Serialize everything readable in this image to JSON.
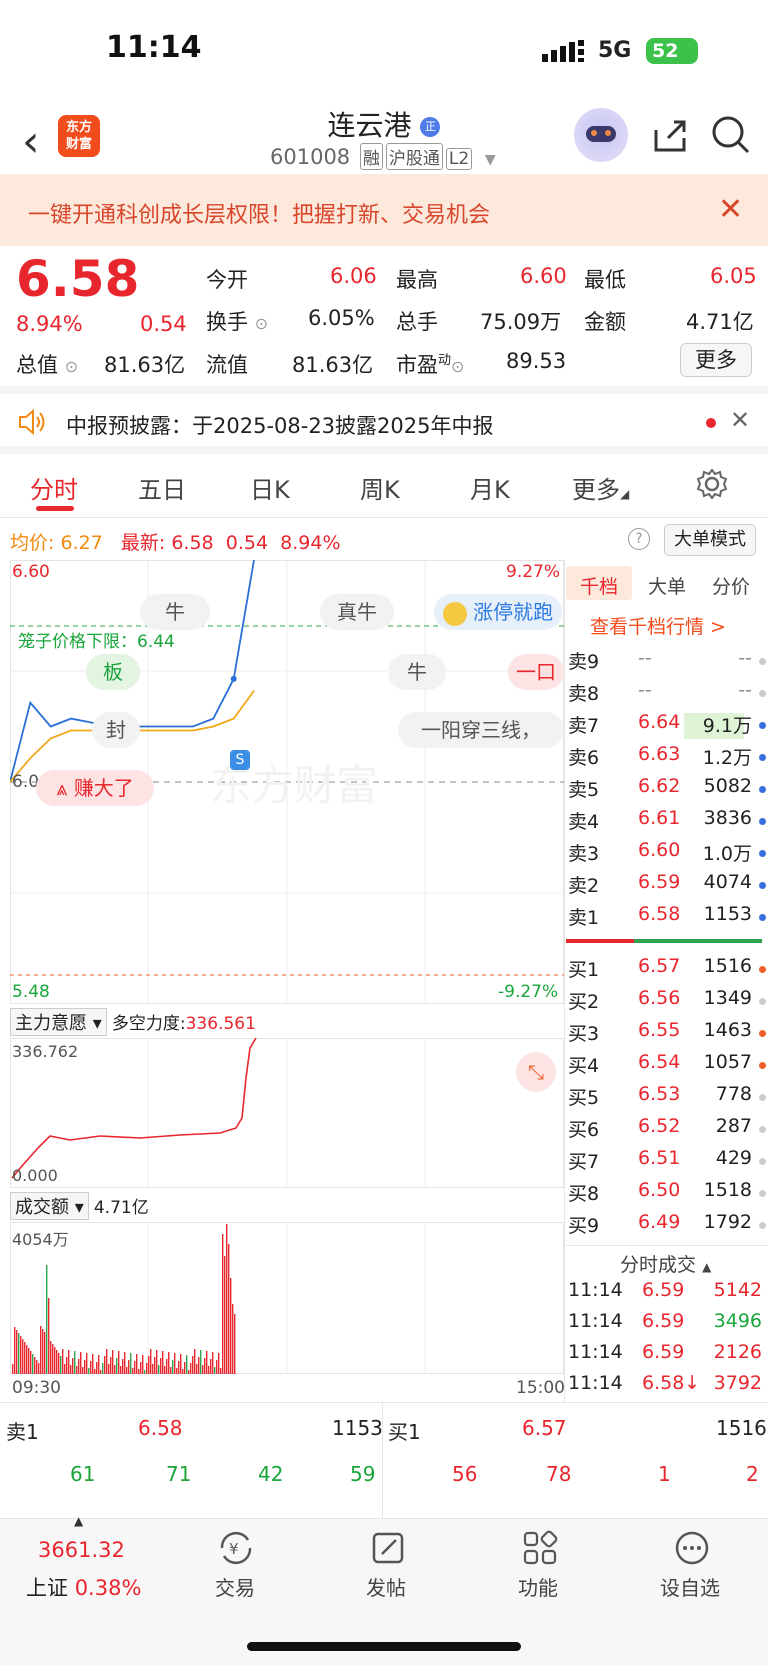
{
  "status": {
    "time": "11:14",
    "network": "5G",
    "battery": "52"
  },
  "header": {
    "title": "连云港",
    "code": "601008",
    "tags": [
      "融",
      "沪股通",
      "L2"
    ],
    "logo": "东方\n财富"
  },
  "banner": {
    "text": "一键开通科创成长层权限！把握打新、交易机会"
  },
  "quote": {
    "price": "6.58",
    "pct": "8.94%",
    "change": "0.54",
    "open_label": "今开",
    "open": "6.06",
    "high_label": "最高",
    "high": "6.60",
    "low_label": "最低",
    "low": "6.05",
    "turnover_label": "换手",
    "turnover": "6.05%",
    "volume_label": "总手",
    "volume": "75.09万",
    "amount_label": "金额",
    "amount": "4.71亿",
    "mktcap_label": "总值",
    "mktcap": "81.63亿",
    "float_label": "流值",
    "float": "81.63亿",
    "pe_label": "市盈",
    "pe_sup": "动",
    "pe": "89.53",
    "more": "更多"
  },
  "notice": {
    "text": "中报预披露：于2025-08-23披露2025年中报"
  },
  "tabs": [
    "分时",
    "五日",
    "日K",
    "周K",
    "月K",
    "更多"
  ],
  "chart_bar": {
    "avg_label": "均价:",
    "avg": "6.27",
    "latest_label": "最新:",
    "latest": "6.58",
    "chg": "0.54",
    "pct": "8.94%",
    "mode": "大单模式"
  },
  "price_chart": {
    "top_left": "6.60",
    "top_right": "9.27%",
    "mid_left": "6.04",
    "bottom_left": "5.48",
    "bottom_right": "-9.27%",
    "cage_label": "笼子价格下限：6.44",
    "bubbles": [
      "牛",
      "真牛",
      "涨停就跑",
      "板",
      "牛",
      "一口",
      "封",
      "一阳穿三线，",
      "赚大了"
    ],
    "watermark": "东方财富",
    "marker": "S"
  },
  "indicator": {
    "name": "主力意愿",
    "label": "多空力度:",
    "value": "336.561",
    "max": "336.762",
    "min": "0.000"
  },
  "volume_chart": {
    "name": "成交额",
    "value": "4.71亿",
    "max": "4054万",
    "start_time": "09:30",
    "end_time": "15:00"
  },
  "chart_data": {
    "type": "line",
    "title": "",
    "xlabel": "",
    "ylabel": "",
    "x": [
      "09:30",
      "09:40",
      "09:50",
      "10:00",
      "10:10",
      "10:20",
      "10:30",
      "10:40",
      "10:50",
      "11:00",
      "11:05",
      "11:10",
      "11:14"
    ],
    "ylim": [
      5.48,
      6.6
    ],
    "series": [
      {
        "values": [
          6.04,
          6.24,
          6.18,
          6.2,
          6.19,
          6.18,
          6.18,
          6.18,
          6.18,
          6.18,
          6.2,
          6.3,
          6.6
        ]
      },
      {
        "values": [
          6.04,
          6.1,
          6.15,
          6.17,
          6.17,
          6.17,
          6.17,
          6.17,
          6.17,
          6.17,
          6.18,
          6.2,
          6.27
        ]
      }
    ]
  },
  "orderbook": {
    "tabs": [
      "千档",
      "大单",
      "分价"
    ],
    "link": "查看千档行情 >",
    "asks": [
      {
        "label": "卖9",
        "price": "--",
        "vol": "--"
      },
      {
        "label": "卖8",
        "price": "--",
        "vol": "--"
      },
      {
        "label": "卖7",
        "price": "6.64",
        "vol": "9.1万"
      },
      {
        "label": "卖6",
        "price": "6.63",
        "vol": "1.2万"
      },
      {
        "label": "卖5",
        "price": "6.62",
        "vol": "5082"
      },
      {
        "label": "卖4",
        "price": "6.61",
        "vol": "3836"
      },
      {
        "label": "卖3",
        "price": "6.60",
        "vol": "1.0万"
      },
      {
        "label": "卖2",
        "price": "6.59",
        "vol": "4074"
      },
      {
        "label": "卖1",
        "price": "6.58",
        "vol": "1153"
      }
    ],
    "bids": [
      {
        "label": "买1",
        "price": "6.57",
        "vol": "1516"
      },
      {
        "label": "买2",
        "price": "6.56",
        "vol": "1349"
      },
      {
        "label": "买3",
        "price": "6.55",
        "vol": "1463"
      },
      {
        "label": "买4",
        "price": "6.54",
        "vol": "1057"
      },
      {
        "label": "买5",
        "price": "6.53",
        "vol": "778"
      },
      {
        "label": "买6",
        "price": "6.52",
        "vol": "287"
      },
      {
        "label": "买7",
        "price": "6.51",
        "vol": "429"
      },
      {
        "label": "买8",
        "price": "6.50",
        "vol": "1518"
      },
      {
        "label": "买9",
        "price": "6.49",
        "vol": "1792"
      }
    ],
    "ticks_title": "分时成交",
    "ticks": [
      {
        "time": "11:14",
        "price": "6.59",
        "vol": "5142"
      },
      {
        "time": "11:14",
        "price": "6.59",
        "vol": "3496"
      },
      {
        "time": "11:14",
        "price": "6.59",
        "vol": "2126"
      },
      {
        "time": "11:14",
        "price": "6.58↓",
        "vol": "3792"
      }
    ]
  },
  "level1": {
    "sell_label": "卖1",
    "sell_price": "6.58",
    "sell_vol": "1153",
    "buy_label": "买1",
    "buy_price": "6.57",
    "buy_vol": "1516",
    "sell_row": [
      "61",
      "71",
      "42",
      "59"
    ],
    "buy_row": [
      "56",
      "78",
      "1",
      "2"
    ]
  },
  "bottom_nav": {
    "index_value": "3661.32",
    "index_name": "上证",
    "index_pct": "0.38%",
    "items": [
      "交易",
      "发帖",
      "功能",
      "设自选"
    ]
  }
}
